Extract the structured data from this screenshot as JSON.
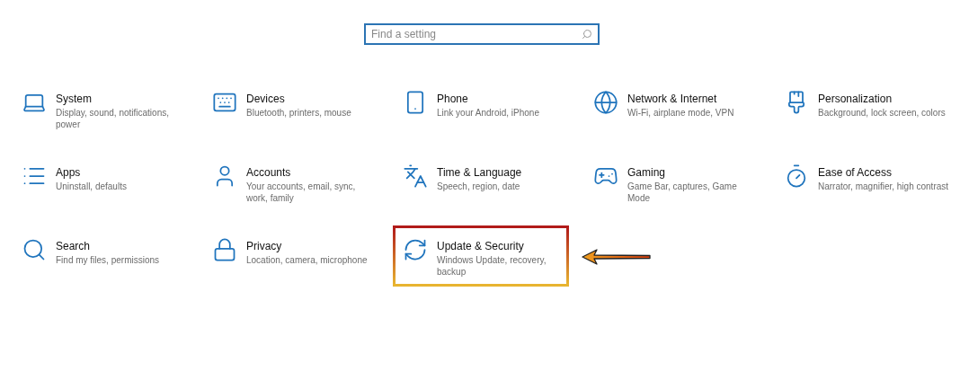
{
  "search": {
    "placeholder": "Find a setting"
  },
  "categories": [
    {
      "title": "System",
      "description": "Display, sound, notifications, power",
      "highlighted": false
    },
    {
      "title": "Devices",
      "description": "Bluetooth, printers, mouse",
      "highlighted": false
    },
    {
      "title": "Phone",
      "description": "Link your Android, iPhone",
      "highlighted": false
    },
    {
      "title": "Network & Internet",
      "description": "Wi-Fi, airplane mode, VPN",
      "highlighted": false
    },
    {
      "title": "Personalization",
      "description": "Background, lock screen, colors",
      "highlighted": false
    },
    {
      "title": "Apps",
      "description": "Uninstall, defaults",
      "highlighted": false
    },
    {
      "title": "Accounts",
      "description": "Your accounts, email, sync, work, family",
      "highlighted": false
    },
    {
      "title": "Time & Language",
      "description": "Speech, region, date",
      "highlighted": false
    },
    {
      "title": "Gaming",
      "description": "Game Bar, captures, Game Mode",
      "highlighted": false
    },
    {
      "title": "Ease of Access",
      "description": "Narrator, magnifier, high contrast",
      "highlighted": false
    },
    {
      "title": "Search",
      "description": "Find my files, permissions",
      "highlighted": false
    },
    {
      "title": "Privacy",
      "description": "Location, camera, microphone",
      "highlighted": false
    },
    {
      "title": "Update & Security",
      "description": "Windows Update, recovery, backup",
      "highlighted": true
    }
  ]
}
